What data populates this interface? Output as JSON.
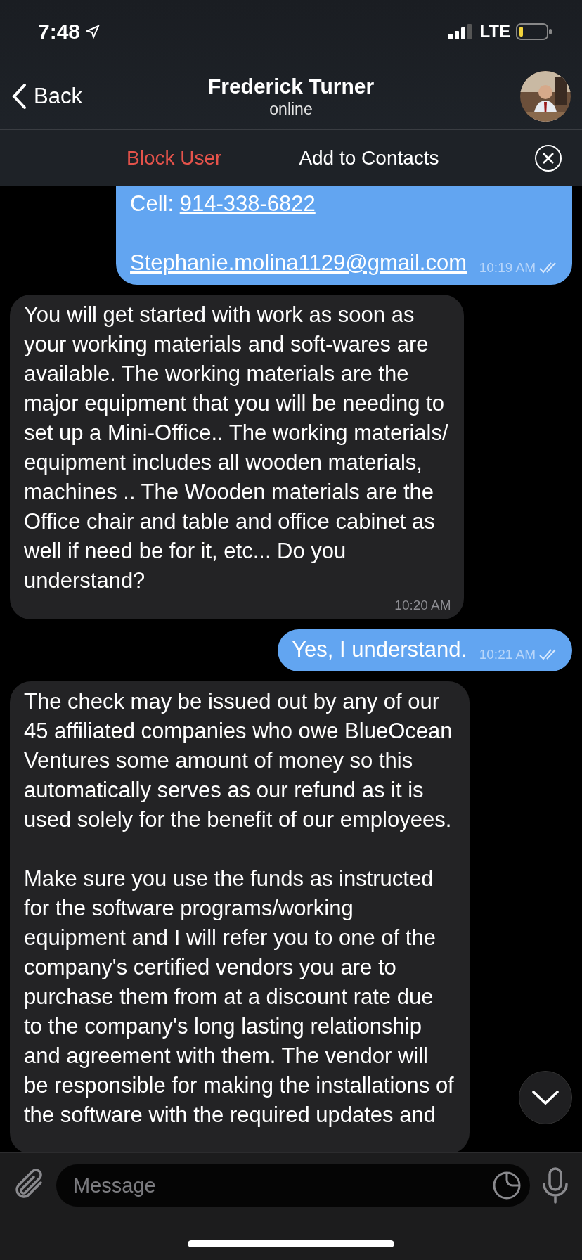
{
  "status_bar": {
    "time": "7:48",
    "network": "LTE"
  },
  "header": {
    "back": "Back",
    "name": "Frederick Turner",
    "status": "online"
  },
  "action_bar": {
    "block": "Block User",
    "add": "Add to Contacts"
  },
  "messages": [
    {
      "kind": "outgoing",
      "cut_top": true,
      "time": "10:19 AM",
      "read": true,
      "lines": [
        {
          "kind": "link_line",
          "label": "Cell:",
          "link": "914-338-6822"
        },
        {
          "kind": "blank"
        },
        {
          "kind": "link",
          "link": "Stephanie.molina1129@gmail.com"
        }
      ]
    },
    {
      "kind": "incoming",
      "cut_top": false,
      "time": "10:20 AM",
      "lines": [
        {
          "kind": "text",
          "text": "You will get started with work as soon as\nyour working materials and soft-wares are\navailable. The working materials are the\nmajor equipment that you will be needing to\nset up a Mini-Office.. The working materials/\nequipment includes all wooden materials,\nmachines .. The Wooden materials are the\nOffice chair and table and office cabinet as\nwell if need be for it, etc... Do you\nunderstand?"
        }
      ]
    },
    {
      "kind": "outgoing",
      "cut_top": false,
      "time": "10:21 AM",
      "read": true,
      "lines": [
        {
          "kind": "text",
          "text": "Yes, I understand."
        }
      ]
    },
    {
      "kind": "incoming",
      "cut_top": false,
      "lines": [
        {
          "kind": "text",
          "text": "The check may be issued out by any of our\n45 affiliated companies who owe BlueOcean\nVentures some amount of money so this\nautomatically serves as our refund as it is\nused solely for the benefit of our employees."
        },
        {
          "kind": "blank"
        },
        {
          "kind": "text",
          "text": "Make sure you use the funds as instructed\nfor the software programs/working\nequipment and I will refer you to one of the\ncompany's certified vendors you are to\npurchase them from at a discount rate due\nto the company's long lasting relationship\nand agreement with them. The vendor will\nbe responsible for making the installations of\nthe software with the required updates and"
        }
      ]
    }
  ],
  "composer": {
    "placeholder": "Message"
  }
}
